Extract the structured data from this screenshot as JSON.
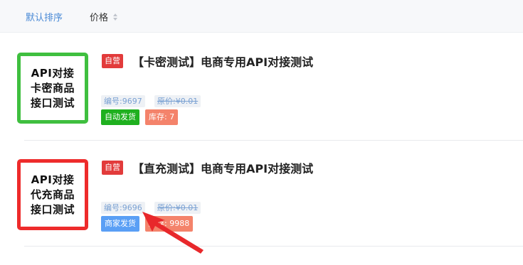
{
  "sortbar": {
    "default_label": "默认排序",
    "price_label": "价格"
  },
  "products": [
    {
      "thumb_lines": [
        "API对接",
        "卡密商品",
        "接口测试"
      ],
      "thumb_border_color": "#3fbf3f",
      "badge": "自营",
      "title": "【卡密测试】电商专用API对接测试",
      "sku_label": "编号:",
      "sku": "9697",
      "orig_label": "原价:",
      "orig_price": "¥0.01",
      "delivery_tag": "自动发货",
      "stock_label": "库存: ",
      "stock": "7"
    },
    {
      "thumb_lines": [
        "API对接",
        "代充商品",
        "接口测试"
      ],
      "thumb_border_color": "#ee2b2b",
      "badge": "自营",
      "title": "【直充测试】电商专用API对接测试",
      "sku_label": "编号:",
      "sku": "9696",
      "orig_label": "原价:",
      "orig_price": "¥0.01",
      "delivery_tag": "商家发货",
      "stock_label": "库存: ",
      "stock": "9988"
    }
  ],
  "colors": {
    "accent_blue": "#4a8ad6",
    "badge_red": "#e23b3b",
    "auto_green": "#1fb01f",
    "merchant_blue": "#5a9ff5",
    "stock_orange": "#f4836b",
    "annotation_arrow": "#e8282b"
  },
  "icons": {
    "sort": "sort-caret-icon",
    "annotation": "red-arrow-annotation"
  }
}
